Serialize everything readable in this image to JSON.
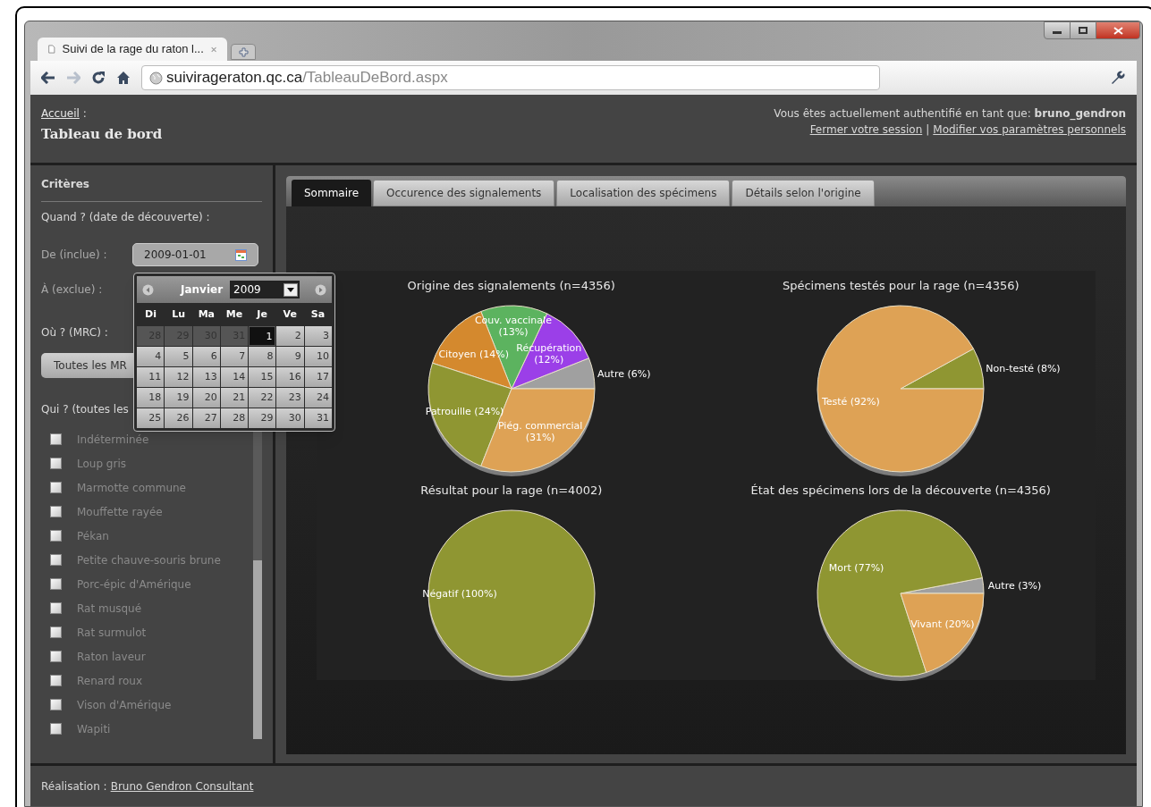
{
  "browser": {
    "tab_title": "Suivi de la rage du raton l...",
    "url_host": "suivirageraton.qc.ca",
    "url_path": "/TableauDeBord.aspx"
  },
  "header": {
    "breadcrumb_link": "Accueil",
    "breadcrumb_sep": ":",
    "page_title": "Tableau de bord",
    "auth_text": "Vous êtes actuellement authentifié en tant que: **bruno_gendron**",
    "links": [
      "Fermer votre session",
      "Modifier vos paramètres personnels"
    ],
    "link_sep": "|"
  },
  "sidebar": {
    "title": "Critères",
    "when_label": "Quand ? (date de découverte) :",
    "from_label": "De (inclue) :",
    "from_value": "2009-01-01",
    "to_label": "À (exclue) :",
    "where_label": "Où ? (MRC) :",
    "mrc_button": "Toutes les MR",
    "who_label": "Qui ? (toutes les",
    "species": [
      {
        "label": "Indéterminée",
        "checked": false
      },
      {
        "label": "Loup gris",
        "checked": false
      },
      {
        "label": "Marmotte commune",
        "checked": false
      },
      {
        "label": "Mouffette rayée",
        "checked": false
      },
      {
        "label": "Pékan",
        "checked": false
      },
      {
        "label": "Petite chauve-souris brune",
        "checked": false
      },
      {
        "label": "Porc-épic d'Amérique",
        "checked": false
      },
      {
        "label": "Rat musqué",
        "checked": false
      },
      {
        "label": "Rat surmulot",
        "checked": false
      },
      {
        "label": "Raton laveur",
        "checked": false
      },
      {
        "label": "Renard roux",
        "checked": false
      },
      {
        "label": "Vison d'Amérique",
        "checked": false
      },
      {
        "label": "Wapiti",
        "checked": false
      }
    ]
  },
  "calendar": {
    "month": "Janvier",
    "year": "2009",
    "weekdays": [
      "Di",
      "Lu",
      "Ma",
      "Me",
      "Je",
      "Ve",
      "Sa"
    ],
    "weeks": [
      [
        {
          "day": "28",
          "kind": "other",
          "selected": false
        },
        {
          "day": "29",
          "kind": "other",
          "selected": false
        },
        {
          "day": "30",
          "kind": "other",
          "selected": false
        },
        {
          "day": "31",
          "kind": "other",
          "selected": false
        },
        {
          "day": "1",
          "kind": "day",
          "selected": true
        },
        {
          "day": "2",
          "kind": "day",
          "selected": false
        },
        {
          "day": "3",
          "kind": "day",
          "selected": false
        }
      ],
      [
        {
          "day": "4",
          "kind": "day",
          "selected": false
        },
        {
          "day": "5",
          "kind": "day",
          "selected": false
        },
        {
          "day": "6",
          "kind": "day",
          "selected": false
        },
        {
          "day": "7",
          "kind": "day",
          "selected": false
        },
        {
          "day": "8",
          "kind": "day",
          "selected": false
        },
        {
          "day": "9",
          "kind": "day",
          "selected": false
        },
        {
          "day": "10",
          "kind": "day",
          "selected": false
        }
      ],
      [
        {
          "day": "11",
          "kind": "day",
          "selected": false
        },
        {
          "day": "12",
          "kind": "day",
          "selected": false
        },
        {
          "day": "13",
          "kind": "day",
          "selected": false
        },
        {
          "day": "14",
          "kind": "day",
          "selected": false
        },
        {
          "day": "15",
          "kind": "day",
          "selected": false
        },
        {
          "day": "16",
          "kind": "day",
          "selected": false
        },
        {
          "day": "17",
          "kind": "day",
          "selected": false
        }
      ],
      [
        {
          "day": "18",
          "kind": "day",
          "selected": false
        },
        {
          "day": "19",
          "kind": "day",
          "selected": false
        },
        {
          "day": "20",
          "kind": "day",
          "selected": false
        },
        {
          "day": "21",
          "kind": "day",
          "selected": false
        },
        {
          "day": "22",
          "kind": "day",
          "selected": false
        },
        {
          "day": "23",
          "kind": "day",
          "selected": false
        },
        {
          "day": "24",
          "kind": "day",
          "selected": false
        }
      ],
      [
        {
          "day": "25",
          "kind": "day",
          "selected": false
        },
        {
          "day": "26",
          "kind": "day",
          "selected": false
        },
        {
          "day": "27",
          "kind": "day",
          "selected": false
        },
        {
          "day": "28",
          "kind": "day",
          "selected": false
        },
        {
          "day": "29",
          "kind": "day",
          "selected": false
        },
        {
          "day": "30",
          "kind": "day",
          "selected": false
        },
        {
          "day": "31",
          "kind": "day",
          "selected": false
        }
      ]
    ]
  },
  "tabs": [
    {
      "label": "Sommaire",
      "selected": true
    },
    {
      "label": "Occurence des signalements",
      "selected": false
    },
    {
      "label": "Localisation des spécimens",
      "selected": false
    },
    {
      "label": "Détails selon l'origine",
      "selected": false
    }
  ],
  "charts": [
    {
      "chart_data": {
        "type": "pie",
        "title": "Origine des signalements (n=4356)",
        "categories": [
          "Autre (6%)",
          "Récupération (12%)",
          "Couv. vaccinale (13%)",
          "Citoyen (14%)",
          "Patrouille (24%)",
          "Piég. commercial (31%)"
        ],
        "values": [
          6,
          12,
          13,
          14,
          24,
          31
        ],
        "colors": [
          "#a0a0a0",
          "#9b3fe8",
          "#5cb35f",
          "#d4892e",
          "#8f9632",
          "#dea255"
        ]
      }
    },
    {
      "chart_data": {
        "type": "pie",
        "title": "Spécimens testés pour la rage (n=4356)",
        "categories": [
          "Non-testé (8%)",
          "Testé (92%)"
        ],
        "values": [
          8,
          92
        ],
        "colors": [
          "#8f9632",
          "#dea255"
        ]
      }
    },
    {
      "chart_data": {
        "type": "pie",
        "title": "Résultat pour la rage (n=4002)",
        "categories": [
          "Négatif (100%)"
        ],
        "values": [
          100
        ],
        "colors": [
          "#8f9632"
        ]
      }
    },
    {
      "chart_data": {
        "type": "pie",
        "title": "État des spécimens lors de la découverte (n=4356)",
        "categories": [
          "Autre (3%)",
          "Mort (77%)",
          "Vivant (20%)"
        ],
        "values": [
          3,
          77,
          20
        ],
        "colors": [
          "#a0a0a0",
          "#8f9632",
          "#dea255"
        ]
      }
    }
  ],
  "footer": {
    "label": "Réalisation :",
    "link": "Bruno Gendron Consultant"
  }
}
